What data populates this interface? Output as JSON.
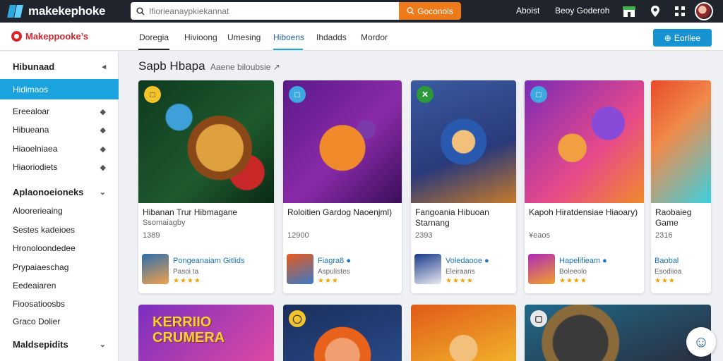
{
  "topbar": {
    "logo": "makekephoke",
    "search_placeholder": "Ifiorieanaypkiekannat",
    "search_button": "Goconols",
    "links": [
      "Aboist",
      "Beoy Goderoh"
    ],
    "icons": [
      "store-icon",
      "location-icon",
      "apps-grid-icon"
    ]
  },
  "subbar": {
    "brand": "Makeppooke’s",
    "tabs": [
      {
        "label": "Doregia",
        "active": false
      },
      {
        "label": "Hivioong",
        "active": false
      },
      {
        "label": "Umesing",
        "active": false
      },
      {
        "label": "Hiboens",
        "active": true
      },
      {
        "label": "Ihdadds",
        "active": false
      },
      {
        "label": "Mordor",
        "active": false
      }
    ],
    "action_button": "Eorllee"
  },
  "sidebar": {
    "header": "Hibunaad",
    "active_item": "Hidimaos",
    "items": [
      "Ereealoar",
      "Hibueana",
      "Hiaoelniaea",
      "Hiaoriodiets"
    ],
    "group2_header": "Aplaonoeioneks",
    "group2_items": [
      "Aloorerieaing",
      "Sestes kadeioes",
      "Hronoloondedee",
      "Prypaiaeschag",
      "Eedeaiaren",
      "Fioosatioosbs",
      "Graco Dolier"
    ],
    "group3_header": "Maldsepidits"
  },
  "main": {
    "section_title": "Sapb Hbapa",
    "section_subtitle": "Aaene biloubsie ↗",
    "cards": [
      {
        "title": "Hibanan Trur Hibmagane",
        "subtitle": "Ssomaiagby",
        "meta": "1389",
        "app_name": "Pongeanaiam Gitlids",
        "app_meta": "Pasoi ta",
        "stars": "★★★★",
        "badge": "□",
        "colors": [
          "#0e3a1f",
          "#c2741c"
        ]
      },
      {
        "title": "Roloitien Gardog Naoenjml)",
        "subtitle": "",
        "meta": "12900",
        "app_name": "Fiagra8 ●",
        "app_meta": "Aspulistes",
        "stars": "★★★",
        "badge": "□",
        "colors": [
          "#6a1e8e",
          "#e8621c"
        ]
      },
      {
        "title": "Fangoania Hibuoan Starnang",
        "subtitle": "",
        "meta": "2393",
        "app_name": "Voledaooe ●",
        "app_meta": "Eleiraans",
        "stars": "★★★★",
        "badge": "✕",
        "colors": [
          "#2a4a8a",
          "#d9911c"
        ]
      },
      {
        "title": "Kapoh Hiratdensiae Hiaoary)",
        "subtitle": "",
        "meta": "¥eaos",
        "app_name": "Hapelifieam ●",
        "app_meta": "Boleeolo",
        "stars": "★★★★",
        "badge": "□",
        "colors": [
          "#6e2ea8",
          "#ee6a26"
        ]
      },
      {
        "title": "Raobaieg Game",
        "subtitle": "",
        "meta": "2316",
        "app_name": "Baobal",
        "app_meta": "Esodiioa",
        "stars": "★★★",
        "badge": "",
        "colors": [
          "#d8d8d8",
          "#eeeeee"
        ]
      }
    ],
    "bottom_cards": [
      {
        "text": "KERRIIO CRUMERA",
        "colors": [
          "#7b2fc1",
          "#e24aa0"
        ]
      },
      {
        "text": "",
        "colors": [
          "#1a2f5c",
          "#e66a1e"
        ]
      },
      {
        "text": "",
        "colors": [
          "#e05a1a",
          "#f3b82a"
        ]
      },
      {
        "text": "",
        "colors": [
          "#1f6a8a",
          "#2a2a3a"
        ]
      }
    ]
  }
}
